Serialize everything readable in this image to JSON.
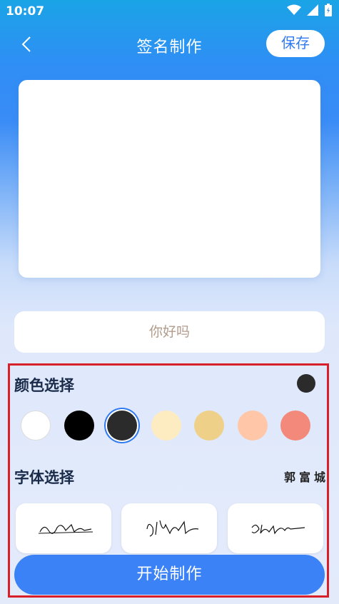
{
  "status_bar": {
    "time": "10:07",
    "icons": [
      "wifi-icon",
      "signal-icon",
      "battery-icon"
    ]
  },
  "header": {
    "title": "签名制作",
    "save_label": "保存",
    "back_icon": "chevron-left-icon"
  },
  "text_input": {
    "value": "你好吗"
  },
  "color_section": {
    "label": "颜色选择",
    "selected_color": "#2b2b2b",
    "swatches": [
      "#ffffff",
      "#000000",
      "#2b2b2b",
      "#fdebc2",
      "#eed088",
      "#ffc6a8",
      "#f2897a"
    ]
  },
  "font_section": {
    "label": "字体选择",
    "preview_text": "郭富城",
    "cards": [
      "signature-style-1",
      "signature-style-2",
      "signature-style-3"
    ]
  },
  "start_button": {
    "label": "开始制作"
  },
  "colors": {
    "accent": "#3b82f6",
    "highlight_border": "#d7202a"
  }
}
